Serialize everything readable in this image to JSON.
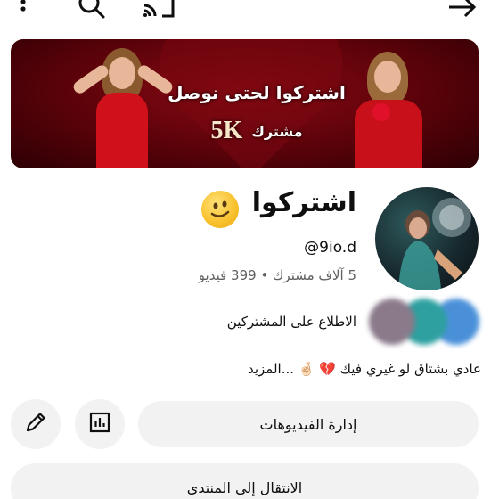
{
  "topbar": {
    "icons": [
      "more-vertical-icon",
      "search-icon",
      "cast-icon",
      "forward-arrow-icon"
    ]
  },
  "banner": {
    "line1": "اشتركوا لحتى نوصل",
    "number": "5K",
    "line2": "مشترك"
  },
  "channel": {
    "name": "اشتركوا",
    "emoji": "melting-face-emoji",
    "handle": "@9io.d",
    "stats": "5 آلاف مشترك • 399 فيديو"
  },
  "subscribers": {
    "label": "الاطلاع على المشتركين"
  },
  "description": {
    "text": "عادي بشتاق لو غيري فيك 💔 🤞🏻 ...المزيد"
  },
  "actions": {
    "manage_videos": "إدارة الفيديوهات",
    "go_to_community": "الانتقال إلى المنتدى"
  },
  "colors": {
    "banner_red": "#6b0510",
    "button_bg": "#f2f2f2",
    "secondary_text": "#606060"
  }
}
